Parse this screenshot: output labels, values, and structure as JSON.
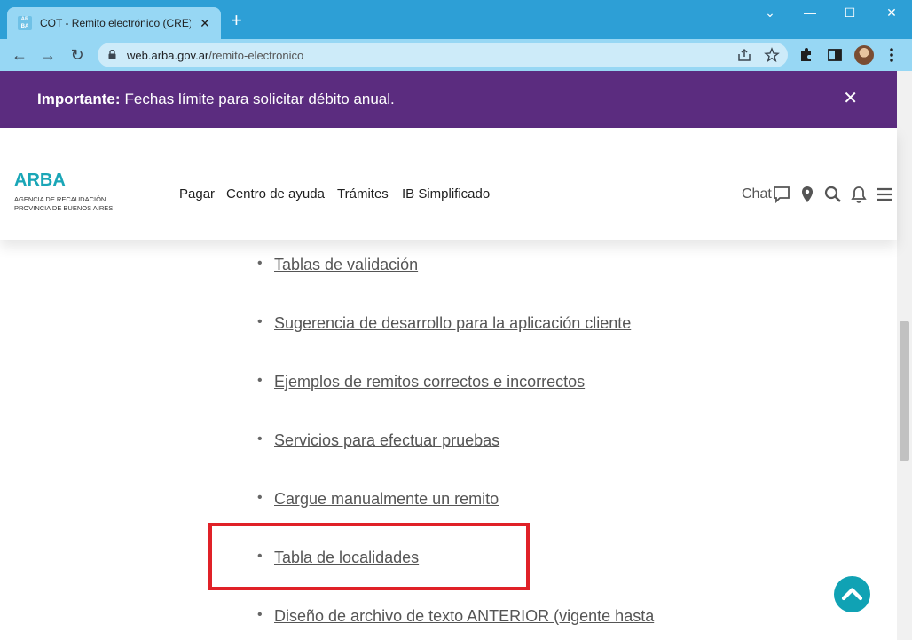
{
  "browser": {
    "tab": {
      "favicon_text": "AR BA",
      "title": "COT - Remito electrónico (CRE) |",
      "close_glyph": "✕"
    },
    "new_tab_glyph": "+",
    "window_controls": {
      "minimize": "—",
      "maximize": "☐",
      "close": "✕",
      "tablist": "⌄"
    },
    "nav": {
      "back": "←",
      "forward": "→",
      "reload": "↻"
    },
    "address": {
      "domain": "web.arba.gov.ar",
      "path": "/remito-electronico"
    }
  },
  "banner": {
    "bold_label": "Importante:",
    "message": "Fechas límite para solicitar débito anual.",
    "close_glyph": "✕",
    "background": "#5b2c7f"
  },
  "header": {
    "logo": {
      "name": "ARBA",
      "subtitle_line1": "AGENCIA DE RECAUDACIÓN",
      "subtitle_line2": "PROVINCIA DE BUENOS AIRES",
      "color": "#1aa6b7"
    },
    "nav": [
      "Pagar",
      "Centro de ayuda",
      "Trámites",
      "IB Simplificado"
    ],
    "chat_label": "Chat",
    "icons": [
      "chat-bubble-icon",
      "location-pin-icon",
      "search-icon",
      "bell-icon",
      "menu-icon"
    ]
  },
  "content": {
    "bullet": "•",
    "items": [
      "Tablas de validación",
      "Sugerencia de desarrollo para la aplicación cliente",
      "Ejemplos de remitos correctos e incorrectos",
      "Servicios para efectuar pruebas",
      "Cargue manualmente un remito",
      "Tabla de localidades",
      "Diseño de archivo de texto ANTERIOR (vigente hasta"
    ],
    "highlighted_item": "Tabla de localidades",
    "highlight_color": "#e02128"
  },
  "scroll_top": {
    "icon": "chevron-up-icon",
    "color": "#10a2b4"
  }
}
